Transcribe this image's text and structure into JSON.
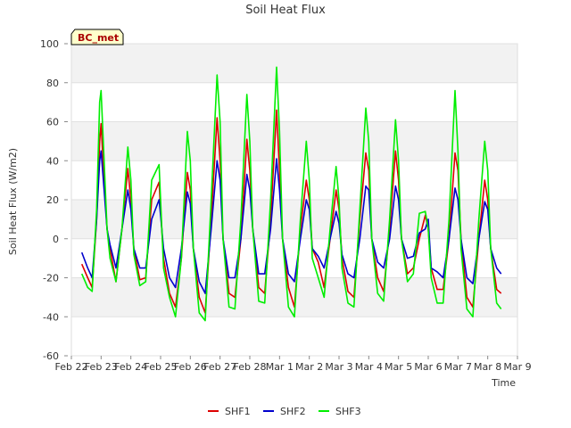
{
  "chart_data": {
    "type": "line",
    "title": "Soil Heat Flux",
    "xlabel": "Time",
    "ylabel": "Soil Heat Flux (W/m2)",
    "ylim": [
      -60,
      100
    ],
    "yticks": [
      -60,
      -40,
      -20,
      0,
      20,
      40,
      60,
      80,
      100
    ],
    "xlim": [
      "Feb 22",
      "Mar 9"
    ],
    "xticks": [
      "Feb 22",
      "Feb 23",
      "Feb 24",
      "Feb 25",
      "Feb 26",
      "Feb 27",
      "Feb 28",
      "Mar 1",
      "Mar 2",
      "Mar 3",
      "Mar 4",
      "Mar 5",
      "Mar 6",
      "Mar 7",
      "Mar 8",
      "Mar 9"
    ],
    "grid": true,
    "legend_position": "bottom",
    "annotation": "BC_met",
    "series": [
      {
        "name": "SHF1",
        "color": "#dd0000",
        "x": [
          0.35,
          0.55,
          0.7,
          0.85,
          0.95,
          1.0,
          1.1,
          1.2,
          1.3,
          1.5,
          1.7,
          1.9,
          2.0,
          2.1,
          2.3,
          2.5,
          2.7,
          2.95,
          3.0,
          3.1,
          3.3,
          3.5,
          3.7,
          3.9,
          4.0,
          4.1,
          4.3,
          4.5,
          4.7,
          4.9,
          5.0,
          5.1,
          5.3,
          5.5,
          5.7,
          5.9,
          6.0,
          6.1,
          6.3,
          6.5,
          6.7,
          6.9,
          7.0,
          7.1,
          7.3,
          7.5,
          7.7,
          7.9,
          8.0,
          8.1,
          8.3,
          8.5,
          8.7,
          8.9,
          9.0,
          9.1,
          9.3,
          9.5,
          9.7,
          9.9,
          10.0,
          10.1,
          10.3,
          10.5,
          10.7,
          10.9,
          11.0,
          11.1,
          11.3,
          11.5,
          11.7,
          11.9,
          12.0,
          12.1,
          12.3,
          12.5,
          12.7,
          12.9,
          13.0,
          13.1,
          13.3,
          13.5,
          13.7,
          13.9,
          14.0,
          14.1,
          14.3,
          14.45
        ],
        "values": [
          -13,
          -20,
          -25,
          10,
          50,
          59,
          30,
          5,
          -5,
          -22,
          5,
          36,
          20,
          -5,
          -21,
          -20,
          20,
          29,
          15,
          -10,
          -28,
          -35,
          -10,
          34,
          25,
          -5,
          -30,
          -38,
          10,
          62,
          40,
          0,
          -28,
          -30,
          0,
          51,
          35,
          5,
          -25,
          -28,
          10,
          66,
          35,
          0,
          -25,
          -35,
          5,
          30,
          20,
          -5,
          -12,
          -25,
          0,
          25,
          15,
          -10,
          -27,
          -30,
          10,
          44,
          35,
          0,
          -20,
          -27,
          5,
          45,
          30,
          0,
          -18,
          -15,
          0,
          12,
          5,
          -15,
          -26,
          -26,
          0,
          44,
          35,
          0,
          -30,
          -35,
          0,
          30,
          20,
          -5,
          -26,
          -28
        ]
      },
      {
        "name": "SHF2",
        "color": "#0000cc",
        "x": [
          0.35,
          0.55,
          0.7,
          0.85,
          0.95,
          1.0,
          1.1,
          1.2,
          1.3,
          1.5,
          1.7,
          1.9,
          2.0,
          2.1,
          2.3,
          2.5,
          2.7,
          2.95,
          3.0,
          3.1,
          3.3,
          3.5,
          3.7,
          3.9,
          4.0,
          4.1,
          4.3,
          4.5,
          4.7,
          4.9,
          5.0,
          5.1,
          5.3,
          5.5,
          5.7,
          5.9,
          6.0,
          6.1,
          6.3,
          6.5,
          6.7,
          6.9,
          7.0,
          7.1,
          7.3,
          7.5,
          7.7,
          7.9,
          8.0,
          8.1,
          8.3,
          8.5,
          8.7,
          8.9,
          9.0,
          9.1,
          9.3,
          9.5,
          9.7,
          9.9,
          10.0,
          10.1,
          10.3,
          10.5,
          10.7,
          10.9,
          11.0,
          11.1,
          11.3,
          11.5,
          11.7,
          11.9,
          12.0,
          12.1,
          12.3,
          12.5,
          12.7,
          12.9,
          13.0,
          13.1,
          13.3,
          13.5,
          13.7,
          13.9,
          14.0,
          14.1,
          14.3,
          14.45
        ],
        "values": [
          -7,
          -15,
          -20,
          10,
          40,
          45,
          25,
          5,
          -3,
          -15,
          5,
          25,
          15,
          -5,
          -15,
          -15,
          10,
          20,
          12,
          -5,
          -20,
          -25,
          -5,
          24,
          18,
          -5,
          -22,
          -28,
          5,
          40,
          30,
          0,
          -20,
          -20,
          0,
          33,
          25,
          5,
          -18,
          -18,
          5,
          41,
          25,
          0,
          -18,
          -22,
          0,
          20,
          15,
          -5,
          -9,
          -15,
          0,
          14,
          8,
          -8,
          -18,
          -20,
          0,
          27,
          25,
          0,
          -12,
          -15,
          0,
          27,
          20,
          0,
          -10,
          -9,
          3,
          5,
          10,
          -15,
          -17,
          -20,
          0,
          26,
          20,
          0,
          -20,
          -23,
          0,
          19,
          15,
          -5,
          -15,
          -18
        ]
      },
      {
        "name": "SHF3",
        "color": "#00ee00",
        "x": [
          0.35,
          0.55,
          0.7,
          0.85,
          0.95,
          1.0,
          1.1,
          1.2,
          1.3,
          1.5,
          1.7,
          1.9,
          2.0,
          2.1,
          2.3,
          2.5,
          2.7,
          2.95,
          3.0,
          3.1,
          3.3,
          3.5,
          3.7,
          3.9,
          4.0,
          4.1,
          4.3,
          4.5,
          4.7,
          4.9,
          5.0,
          5.1,
          5.3,
          5.5,
          5.7,
          5.9,
          6.0,
          6.1,
          6.3,
          6.5,
          6.7,
          6.9,
          7.0,
          7.1,
          7.3,
          7.5,
          7.7,
          7.9,
          8.0,
          8.1,
          8.3,
          8.5,
          8.7,
          8.9,
          9.0,
          9.1,
          9.3,
          9.5,
          9.7,
          9.9,
          10.0,
          10.1,
          10.3,
          10.5,
          10.7,
          10.9,
          11.0,
          11.1,
          11.3,
          11.5,
          11.7,
          11.9,
          12.0,
          12.1,
          12.3,
          12.5,
          12.7,
          12.9,
          13.0,
          13.1,
          13.3,
          13.5,
          13.7,
          13.9,
          14.0,
          14.1,
          14.3,
          14.45
        ],
        "values": [
          -18,
          -25,
          -27,
          15,
          70,
          76,
          40,
          5,
          -10,
          -22,
          5,
          47,
          30,
          -8,
          -24,
          -22,
          30,
          38,
          20,
          -15,
          -30,
          -40,
          -10,
          55,
          40,
          -5,
          -38,
          -42,
          20,
          84,
          60,
          0,
          -35,
          -36,
          10,
          74,
          50,
          5,
          -32,
          -33,
          20,
          88,
          55,
          0,
          -35,
          -40,
          10,
          50,
          30,
          -10,
          -20,
          -30,
          5,
          37,
          20,
          -15,
          -33,
          -35,
          15,
          67,
          50,
          0,
          -28,
          -32,
          10,
          61,
          40,
          0,
          -22,
          -18,
          13,
          14,
          5,
          -20,
          -33,
          -33,
          10,
          76,
          45,
          -5,
          -36,
          -40,
          10,
          50,
          35,
          -5,
          -33,
          -36
        ]
      }
    ]
  }
}
